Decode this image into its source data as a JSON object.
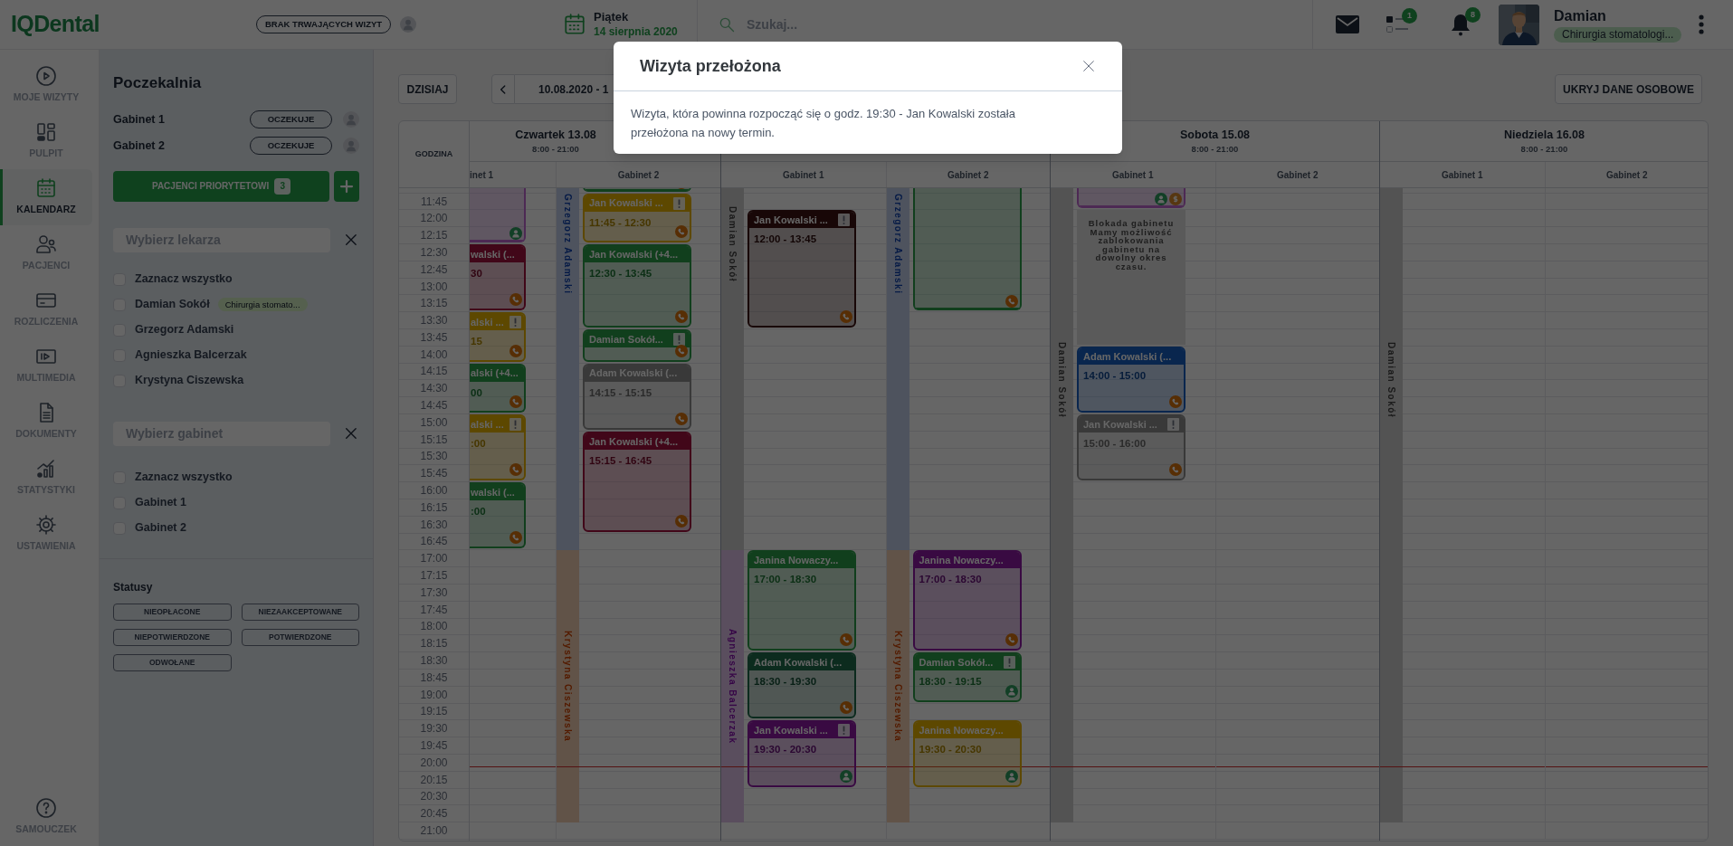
{
  "logo": "IQDental",
  "topbar": {
    "visit_status": "BRAK TRWAJĄCYCH WIZYT",
    "weekday": "Piątek",
    "date": "14 sierpnia 2020",
    "search": {
      "placeholder": "Szukaj..."
    },
    "tasks_badge": "1",
    "notifications_badge": "8",
    "user": {
      "name": "Damian",
      "role": "Chirurgia stomatologi..."
    }
  },
  "nav": [
    {
      "label": "MOJE WIZYTY",
      "selected": false
    },
    {
      "label": "PULPIT",
      "selected": false
    },
    {
      "label": "KALENDARZ",
      "selected": true
    },
    {
      "label": "PACJENCI",
      "selected": false
    },
    {
      "label": "ROZLICZENIA",
      "selected": false
    },
    {
      "label": "MULTIMEDIA",
      "selected": false
    },
    {
      "label": "DOKUMENTY",
      "selected": false
    },
    {
      "label": "STATYSTYKI",
      "selected": false
    },
    {
      "label": "USTAWIENIA",
      "selected": false
    }
  ],
  "nav_help": {
    "label": "SAMOUCZEK"
  },
  "waiting_room": {
    "title": "Poczekalnia",
    "rooms": [
      {
        "name": "Gabinet 1",
        "status": "OCZEKUJE"
      },
      {
        "name": "Gabinet 2",
        "status": "OCZEKUJE"
      }
    ],
    "priority_button": {
      "label": "PACJENCI PRIORYTETOWI",
      "count": "3"
    }
  },
  "doctor_filter": {
    "placeholder": "Wybierz lekarza",
    "options": [
      {
        "label": "Zaznacz wszystko",
        "checked": false
      },
      {
        "label": "Damian Sokół",
        "checked": false,
        "tag": "Chirurgia stomato..."
      },
      {
        "label": "Grzegorz Adamski",
        "checked": false
      },
      {
        "label": "Agnieszka Balcerzak",
        "checked": false
      },
      {
        "label": "Krystyna Ciszewska",
        "checked": false
      }
    ]
  },
  "room_filter": {
    "placeholder": "Wybierz gabinet",
    "options": [
      {
        "label": "Zaznacz wszystko",
        "checked": false
      },
      {
        "label": "Gabinet 1",
        "checked": false
      },
      {
        "label": "Gabinet 2",
        "checked": false
      }
    ]
  },
  "statuses": {
    "title": "Statusy",
    "items": [
      "NIEOPŁACONE",
      "NIEZAAKCEPTOWANE",
      "NIEPOTWIERDZONE",
      "POTWIERDZONE",
      "ODWOŁANE"
    ]
  },
  "toolbar": {
    "today_button": "DZISIAJ",
    "range": "10.08.2020 - 1",
    "hide_button": "UKRYJ DANE OSOBOWE"
  },
  "calendar": {
    "time_header": "GODZINA",
    "times": [
      "11:45",
      "12:00",
      "12:15",
      "12:30",
      "12:45",
      "13:00",
      "13:15",
      "13:30",
      "13:45",
      "14:00",
      "14:15",
      "14:30",
      "14:45",
      "15:00",
      "15:15",
      "15:30",
      "15:45",
      "16:00",
      "16:15",
      "16:30",
      "16:45",
      "17:00",
      "17:15",
      "17:30",
      "17:45",
      "18:00",
      "18:15",
      "18:30",
      "18:45",
      "19:00",
      "19:15",
      "19:30",
      "19:45",
      "20:00",
      "20:15",
      "20:30",
      "20:45",
      "21:00"
    ],
    "days": [
      {
        "title": "Czwartek 13.08",
        "hours": "8:00 - 21:00",
        "partial": true,
        "rooms": [
          {
            "label": "inet 1",
            "appointments": [
              {
                "kind": "appointment",
                "color": "#4d2954",
                "alert": false,
                "phone": false,
                "person": true,
                "dollar": false
              },
              {
                "kind": "appointment",
                "title": "walski (...",
                "time": "30",
                "color": "#410719",
                "alert": false,
                "phone": true,
                "person": false,
                "dollar": false
              },
              {
                "kind": "appointment",
                "title": "alski ...",
                "time": "15",
                "color": "#5d4800",
                "alert": true,
                "phone": true,
                "person": false,
                "dollar": false
              },
              {
                "kind": "appointment",
                "title": "alski (+4...",
                "time": "00",
                "color": "#113f1d",
                "alert": false,
                "phone": true,
                "person": false,
                "dollar": false
              },
              {
                "kind": "appointment",
                "title": "alski ...",
                "time": ":00",
                "color": "#5d4800",
                "alert": true,
                "phone": true,
                "person": false,
                "dollar": false
              },
              {
                "kind": "appointment",
                "title": "walski (...",
                "time": ":00",
                "color": "#113f1d",
                "alert": false,
                "phone": true,
                "person": false,
                "dollar": false
              }
            ]
          },
          {
            "label": "Gabinet 2",
            "stripes": [
              {
                "doctor": "Grzegorz Adamski",
                "color": "#4e535e"
              },
              {
                "doctor": "Krystyna Ciszewska",
                "color": "#615348"
              }
            ],
            "appointments": [
              {
                "kind": "appointment",
                "color": "#113f1d",
                "alert": false,
                "phone": true,
                "person": false,
                "dollar": false
              },
              {
                "kind": "appointment",
                "title": "Jan Kowalski ...",
                "time": "11:45 - 12:30",
                "color": "#5d4800",
                "alert": true,
                "phone": true,
                "person": false,
                "dollar": false
              },
              {
                "kind": "appointment",
                "title": "Jan Kowalski (+4...",
                "time": "12:30 - 13:45",
                "color": "#113f1d",
                "alert": false,
                "phone": true,
                "person": false,
                "dollar": false
              },
              {
                "kind": "appointment",
                "title": "Damian Sokół...",
                "color": "#113f1d",
                "alert": true,
                "phone": true,
                "person": false,
                "dollar": false
              },
              {
                "kind": "appointment",
                "title": "Adam Kowalski (...",
                "time": "14:15 - 15:15",
                "color": "#393939",
                "alert": false,
                "phone": true,
                "person": false,
                "dollar": false
              },
              {
                "kind": "appointment",
                "title": "Jan Kowalski (+4...",
                "time": "15:15 - 16:45",
                "color": "#410719",
                "alert": false,
                "phone": true,
                "person": false,
                "dollar": false
              }
            ]
          }
        ]
      },
      {
        "rooms": [
          {
            "label": "Gabinet 1",
            "stripes": [
              {
                "doctor": "Damian Sokół",
                "color": "#535353"
              },
              {
                "doctor": "Agnieszka Balcerzak",
                "color": "#5a4e5e"
              }
            ],
            "appointments": [
              {
                "kind": "appointment",
                "title": "Jan Kowalski ...",
                "time": "12:00 - 13:45",
                "color": "#180707",
                "alert": true,
                "phone": true,
                "person": false,
                "dollar": false
              },
              {
                "kind": "appointment",
                "title": "Janina Nowaczy...",
                "time": "17:00 - 18:30",
                "color": "#113f1d",
                "alert": false,
                "phone": true,
                "person": false,
                "dollar": false
              },
              {
                "kind": "appointment",
                "title": "Adam Kowalski (...",
                "time": "18:30 - 19:30",
                "color": "#0c2b1e",
                "alert": false,
                "phone": true,
                "person": false,
                "dollar": false
              },
              {
                "kind": "appointment",
                "title": "Jan Kowalski ...",
                "time": "19:30 - 20:30",
                "color": "#390a42",
                "alert": true,
                "phone": false,
                "person": true,
                "dollar": false
              }
            ]
          },
          {
            "label": "Gabinet 2",
            "stripes": [
              {
                "doctor": "Grzegorz Adamski",
                "color": "#4e535e"
              },
              {
                "doctor": "Krystyna Ciszewska",
                "color": "#615348"
              }
            ],
            "appointments": [
              {
                "kind": "appointment",
                "color": "#113f1d",
                "alert": false,
                "phone": true,
                "person": false,
                "dollar": false
              },
              {
                "kind": "appointment",
                "title": "Janina Nowaczy...",
                "time": "17:00 - 18:30",
                "color": "#390a42",
                "alert": false,
                "phone": true,
                "person": false,
                "dollar": false
              },
              {
                "kind": "appointment",
                "title": "Damian Sokół...",
                "time": "18:30 - 19:15",
                "color": "#113f1d",
                "alert": true,
                "phone": false,
                "person": true,
                "dollar": false
              },
              {
                "kind": "appointment",
                "title": "Janina Nowaczy...",
                "time": "19:30 - 20:30",
                "color": "#5d4800",
                "alert": false,
                "phone": false,
                "person": true,
                "dollar": false
              }
            ]
          }
        ]
      },
      {
        "title": "Sobota 15.08",
        "hours": "8:00 - 21:00",
        "rooms": [
          {
            "label": "Gabinet 1",
            "stripes": [
              {
                "doctor": "Damian Sokół",
                "color": "#535353"
              }
            ],
            "appointments": [
              {
                "kind": "appointment",
                "color": "#4d2954",
                "alert": false,
                "phone": false,
                "person": true,
                "dollar": true
              },
              {
                "kind": "block",
                "text": "Blokada gabinetu Mamy możliwość zablokowania gabinetu na dowolny okres czasu."
              },
              {
                "kind": "appointment",
                "title": "Adam Kowalski (...",
                "time": "14:00 - 15:00",
                "color": "#09264e",
                "alert": false,
                "phone": true,
                "person": false,
                "dollar": false
              },
              {
                "kind": "appointment",
                "title": "Jan Kowalski ...",
                "time": "15:00 - 16:00",
                "color": "#393939",
                "alert": true,
                "phone": true,
                "person": false,
                "dollar": false
              }
            ]
          },
          {
            "label": "Gabinet 2"
          }
        ]
      },
      {
        "title": "Niedziela 16.08",
        "hours": "8:00 - 21:00",
        "rooms": [
          {
            "label": "Gabinet 1",
            "stripes": [
              {
                "doctor": "Damian Sokół",
                "color": "#535353"
              }
            ]
          },
          {
            "label": "Gabinet 2"
          }
        ]
      }
    ]
  },
  "modal": {
    "title": "Wizyta przełożona",
    "message": "Wizyta, która powinna rozpocząć się o godz. 19:30 - Jan Kowalski została przełożona na nowy termin."
  }
}
